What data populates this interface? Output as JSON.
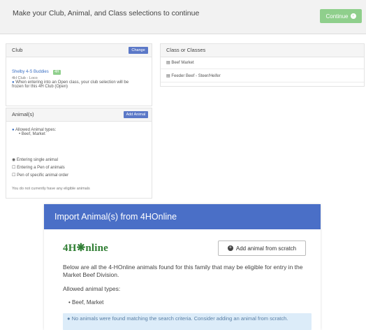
{
  "header": {
    "title": "Make your Club, Animal, and Class selections to continue",
    "continue_label": "Continue"
  },
  "club_panel": {
    "title": "Club",
    "change_label": "Change",
    "club_name": "Shelby 4-S Buddies",
    "badge": "4H",
    "club_sub": "4H Club - Loco",
    "note_prefix": "When entering into an Open class, your club selection will be",
    "note_suffix": "frozen for this 4H Club (Open)"
  },
  "animals_panel": {
    "title": "Animal(s)",
    "add_label": "Add Animal",
    "allowed_label": "Allowed Animal types:",
    "allowed_item": "Beef, Market",
    "options": [
      "Entering single animal",
      "Entering a Pen of animals",
      "Pen of specific animal order"
    ],
    "footnote": "You do not currently have any eligible animals"
  },
  "classes_panel": {
    "title": "Class or Classes",
    "rows": [
      "Beef Market",
      "Feeder Beef - Steer/Heifer"
    ]
  },
  "modal": {
    "title": "Import Animal(s) from 4HOnline",
    "logo_text": "4H❋nline",
    "add_button_label": "Add animal from scratch",
    "description": "Below are all the 4-HOnline animals found for this family that may be eligible for entry in the Market Beef Division.",
    "allowed_title": "Allowed animal types:",
    "allowed_item": "Beef, Market",
    "alert": "No animals were found matching the search criteria. Consider adding an animal from scratch."
  }
}
